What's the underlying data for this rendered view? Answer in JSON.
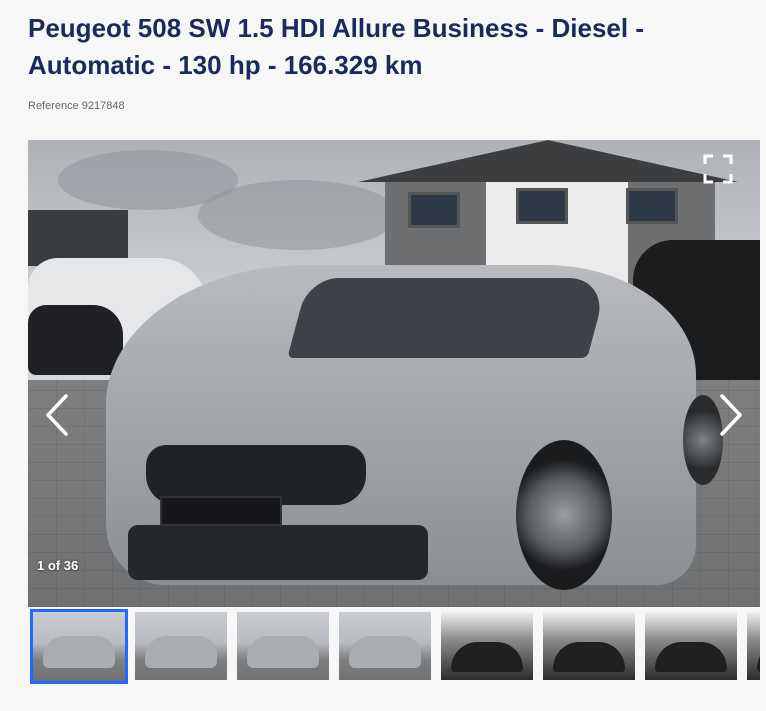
{
  "listing": {
    "title": "Peugeot 508 SW 1.5 HDI Allure Business - Diesel - Automatic - 130 hp - 166.329 km",
    "reference": "Reference 9217848"
  },
  "gallery": {
    "counter": "1 of 36",
    "prev_icon": "chevron-left-icon",
    "next_icon": "chevron-right-icon",
    "expand_icon": "expand-icon",
    "active_color": "#1f6bff"
  },
  "thumbnails": [
    {
      "label": "photo-1",
      "active": true
    },
    {
      "label": "photo-2",
      "active": false
    },
    {
      "label": "photo-3",
      "active": false
    },
    {
      "label": "photo-4",
      "active": false
    },
    {
      "label": "photo-5",
      "active": false
    },
    {
      "label": "photo-6",
      "active": false
    },
    {
      "label": "photo-7",
      "active": false
    },
    {
      "label": "photo-8",
      "active": false
    }
  ]
}
